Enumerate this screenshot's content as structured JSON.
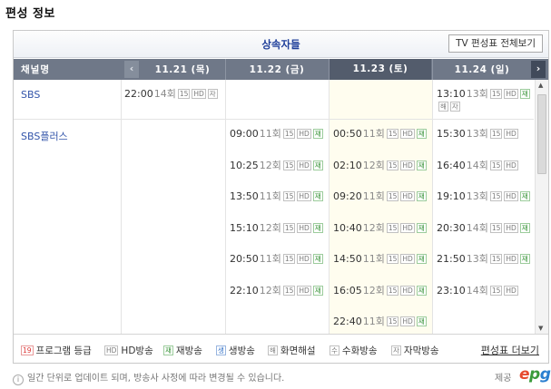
{
  "section_title": "편성 정보",
  "program_title": "상속자들",
  "tv_full_button": "TV 편성표 전체보기",
  "header": {
    "channel_label": "채널명",
    "dates": [
      "11.21 (목)",
      "11.22 (금)",
      "11.23 (토)",
      "11.24 (일)"
    ],
    "today_index": 2
  },
  "channels": [
    {
      "name": "SBS",
      "days": [
        [
          {
            "time": "22:00",
            "ep": "14회",
            "badges": [
              "15",
              "HD",
              "자"
            ]
          }
        ],
        [],
        [],
        [
          {
            "time": "13:10",
            "ep": "13회",
            "badges": [
              "15",
              "HD",
              "재",
              "해",
              "자"
            ]
          }
        ]
      ]
    },
    {
      "name": "SBS플러스",
      "days": [
        [],
        [
          {
            "time": "09:00",
            "ep": "11회",
            "badges": [
              "15",
              "HD",
              "재"
            ]
          },
          {
            "time": "10:25",
            "ep": "12회",
            "badges": [
              "15",
              "HD",
              "재"
            ]
          },
          {
            "time": "13:50",
            "ep": "11회",
            "badges": [
              "15",
              "HD",
              "재"
            ]
          },
          {
            "time": "15:10",
            "ep": "12회",
            "badges": [
              "15",
              "HD",
              "재"
            ]
          },
          {
            "time": "20:50",
            "ep": "11회",
            "badges": [
              "15",
              "HD",
              "재"
            ]
          },
          {
            "time": "22:10",
            "ep": "12회",
            "badges": [
              "15",
              "HD",
              "재"
            ]
          }
        ],
        [
          {
            "time": "00:50",
            "ep": "11회",
            "badges": [
              "15",
              "HD",
              "재"
            ]
          },
          {
            "time": "02:10",
            "ep": "12회",
            "badges": [
              "15",
              "HD",
              "재"
            ]
          },
          {
            "time": "09:20",
            "ep": "11회",
            "badges": [
              "15",
              "HD",
              "재"
            ]
          },
          {
            "time": "10:40",
            "ep": "12회",
            "badges": [
              "15",
              "HD",
              "재"
            ]
          },
          {
            "time": "14:50",
            "ep": "11회",
            "badges": [
              "15",
              "HD",
              "재"
            ]
          },
          {
            "time": "16:05",
            "ep": "12회",
            "badges": [
              "15",
              "HD",
              "재"
            ]
          },
          {
            "time": "22:40",
            "ep": "11회",
            "badges": [
              "15",
              "HD",
              "재"
            ]
          }
        ],
        [
          {
            "time": "15:30",
            "ep": "13회",
            "badges": [
              "15",
              "HD"
            ]
          },
          {
            "time": "16:40",
            "ep": "14회",
            "badges": [
              "15",
              "HD"
            ]
          },
          {
            "time": "19:10",
            "ep": "13회",
            "badges": [
              "15",
              "HD",
              "재"
            ]
          },
          {
            "time": "20:30",
            "ep": "14회",
            "badges": [
              "15",
              "HD",
              "재"
            ]
          },
          {
            "time": "21:50",
            "ep": "13회",
            "badges": [
              "15",
              "HD",
              "재"
            ]
          },
          {
            "time": "23:10",
            "ep": "14회",
            "badges": [
              "15",
              "HD"
            ]
          }
        ]
      ]
    }
  ],
  "legend": [
    {
      "badge": "19",
      "label": "프로그램 등급"
    },
    {
      "badge": "HD",
      "label": "HD방송"
    },
    {
      "badge": "재",
      "label": "재방송"
    },
    {
      "badge": "생",
      "label": "생방송"
    },
    {
      "badge": "해",
      "label": "화면해설"
    },
    {
      "badge": "수",
      "label": "수화방송"
    },
    {
      "badge": "자",
      "label": "자막방송"
    }
  ],
  "more_link": "편성표 더보기",
  "notice": "일간 단위로 업데이트 되며, 방송사 사정에 따라 변경될 수 있습니다.",
  "provider_label": "제공",
  "epg_logo": {
    "e": "e",
    "p": "p",
    "g": "g"
  },
  "icons": {
    "prev": "chevron-left-icon",
    "next": "chevron-right-icon",
    "info": "info-icon"
  },
  "colors": {
    "header_bg": "#6f7888",
    "today_header_bg": "#535c6c",
    "today_column_bg": "#fffdef",
    "program_title": "#1f3f9a",
    "channel_link": "#3355aa",
    "rerun_badge": "#2f8f2f"
  }
}
